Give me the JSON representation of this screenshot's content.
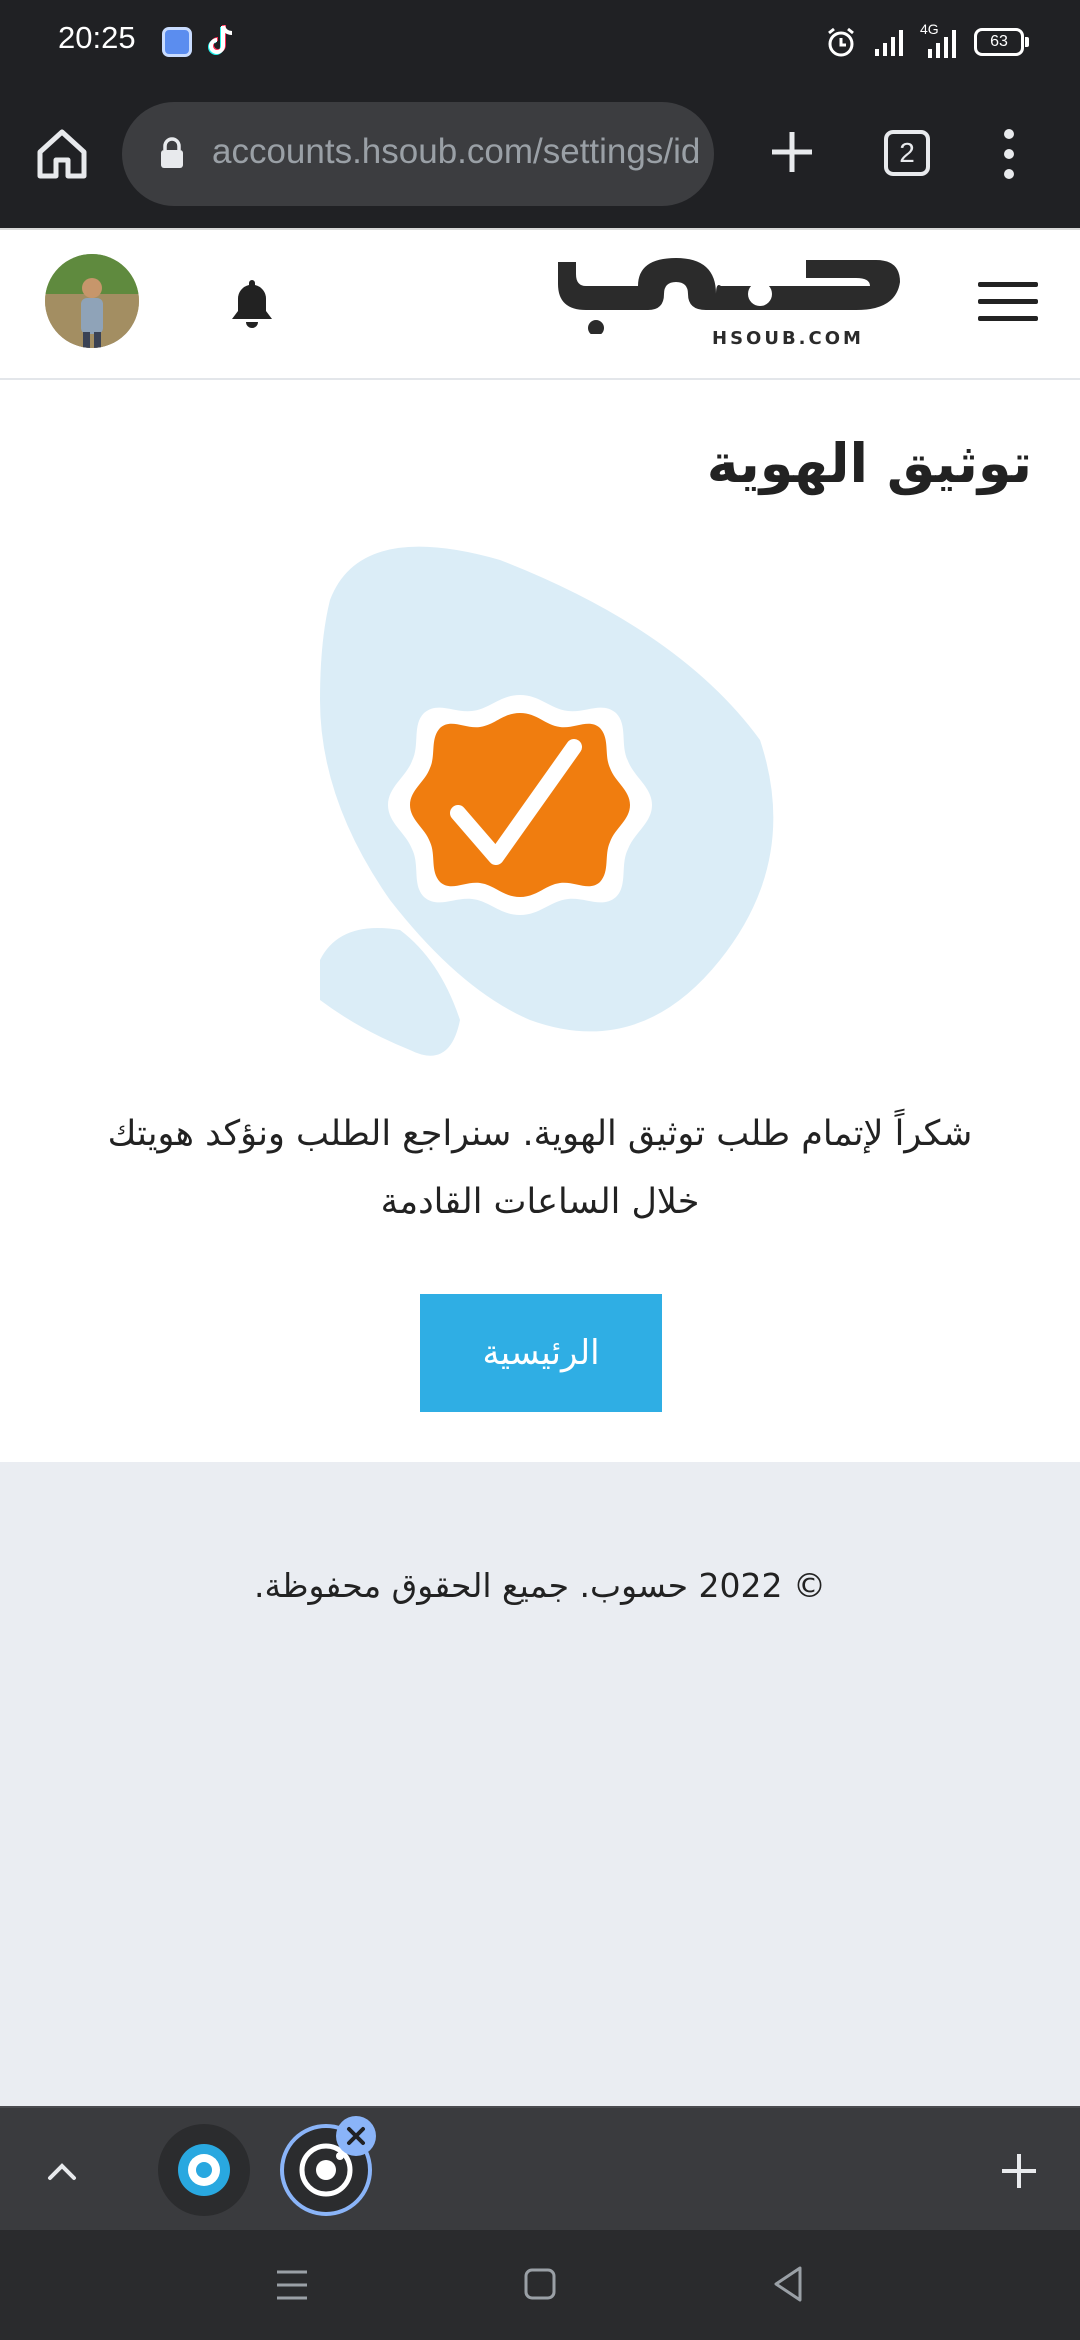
{
  "status_bar": {
    "time": "20:25",
    "network": "4G",
    "battery": "63",
    "icons": [
      "app-icon",
      "tiktok-icon",
      "alarm-icon",
      "signal-icon",
      "signal-4g-icon",
      "battery-icon"
    ]
  },
  "browser": {
    "url": "accounts.hsoub.com/settings/id",
    "tab_count": "2",
    "icons": [
      "home-icon",
      "lock-icon",
      "plus-icon",
      "tabs-icon",
      "more-vert-icon"
    ]
  },
  "header": {
    "logo_text": "حسوب",
    "logo_subtext": "HSOUB.COM",
    "icons": [
      "avatar",
      "bell-icon",
      "hamburger-icon"
    ]
  },
  "main": {
    "title": "توثيق الهوية",
    "message": "شكراً لإتمام طلب توثيق الهوية. سنراجع الطلب ونؤكد هويتك خلال الساعات القادمة",
    "home_button": "الرئيسية"
  },
  "footer": {
    "copyright": "© 2022 حسوب. جميع الحقوق محفوظة."
  },
  "tab_strip": {
    "icons": [
      "chevron-up-icon",
      "tab-thumbnail",
      "tab-thumbnail-active",
      "close-icon",
      "plus-icon"
    ]
  },
  "nav_bar": {
    "icons": [
      "recent-apps-icon",
      "home-nav-icon",
      "back-icon"
    ]
  },
  "colors": {
    "accent_orange": "#f07d0f",
    "button_blue": "#2faee4",
    "blob_light_blue": "#dbedf7",
    "footer_bg": "#eaedf2",
    "chrome_dark": "#202124"
  }
}
